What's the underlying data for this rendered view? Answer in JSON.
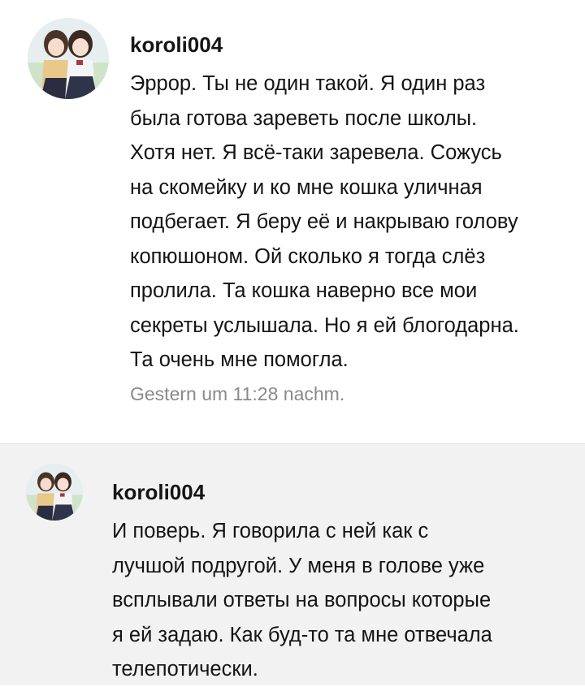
{
  "comments": [
    {
      "username": "koroli004",
      "avatar_icon": "anime-girls-avatar",
      "lines": [
        "Эррор. Ты не один такой. Я один раз",
        "была готова зареветь после школы.",
        "Хотя нет. Я всё-таки заревела. Сожусь",
        "на скомейку и ко мне кошка уличная",
        "подбегает. Я беру её и накрываю голову",
        "копюшоном. Ой сколько я тогда слёз",
        "пролила. Та кошка наверно все мои",
        "секреты услышала. Но я ей блогодарна.",
        "Та очень мне помогла."
      ],
      "timestamp": "Gestern um 11:28 nachm."
    },
    {
      "username": "koroli004",
      "avatar_icon": "anime-girls-avatar",
      "lines": [
        "И поверь. Я говорила с ней как с",
        "лучшой подругой. У меня в голове уже",
        "всплывали ответы на вопросы которые",
        "я ей задаю. Как буд-то та мне отвечала",
        "телепотически."
      ]
    }
  ],
  "colors": {
    "background": "#ffffff",
    "highlight_background": "#f2f2f2",
    "text": "#141414",
    "timestamp": "#8a8a8a"
  }
}
